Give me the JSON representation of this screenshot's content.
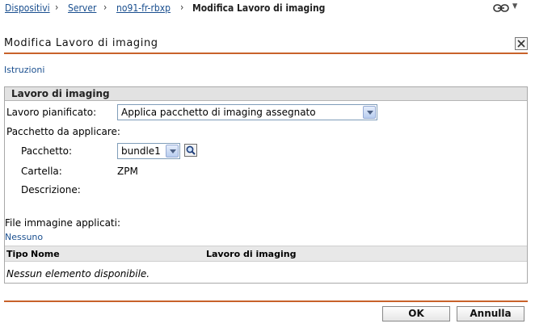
{
  "breadcrumb": {
    "items": [
      "Dispositivi",
      "Server",
      "no91-fr-rbxp"
    ],
    "current": "Modifica Lavoro di imaging",
    "separator": "›"
  },
  "title": "Modifica Lavoro di imaging",
  "instructions_link": "Istruzioni",
  "section": {
    "header": "Lavoro di imaging",
    "scheduled_job_label": "Lavoro pianificato:",
    "scheduled_job_value": "Applica pacchetto di imaging assegnato",
    "bundle_to_apply_label": "Pacchetto da applicare:",
    "bundle_label": "Pacchetto:",
    "bundle_value": "bundle1",
    "folder_label": "Cartella:",
    "folder_value": "ZPM",
    "description_label": "Descrizione:",
    "applied_images_label": "File immagine applicati:",
    "applied_images_value": "Nessuno",
    "table": {
      "columns": [
        "Tipo",
        "Nome",
        "Lavoro di imaging"
      ],
      "empty_message": "Nessun elemento disponibile."
    }
  },
  "buttons": {
    "ok": "OK",
    "cancel": "Annulla"
  },
  "colors": {
    "accent_line": "#c8622a",
    "link": "#1a4f8f",
    "section_header_bg": "#e2e2e2"
  }
}
